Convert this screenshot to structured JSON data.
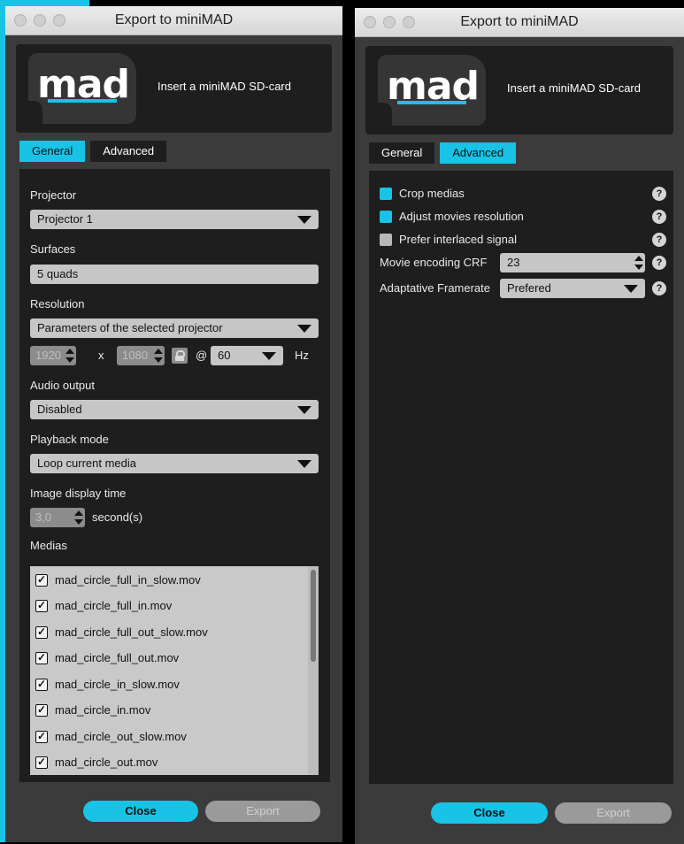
{
  "window_title": "Export to miniMAD",
  "logo_text": "mad",
  "insert_text": "Insert a miniMAD SD-card",
  "tabs": {
    "general": "General",
    "advanced": "Advanced"
  },
  "general": {
    "projector_label": "Projector",
    "projector_value": "Projector 1",
    "surfaces_label": "Surfaces",
    "surfaces_value": "5 quads",
    "resolution_label": "Resolution",
    "resolution_value": "Parameters of the selected projector",
    "width_value": "1920",
    "height_value": "1080",
    "x_sep": "x",
    "at_sep": "@",
    "refresh_value": "60",
    "hz_label": "Hz",
    "audio_label": "Audio output",
    "audio_value": "Disabled",
    "playback_label": "Playback mode",
    "playback_value": "Loop current media",
    "image_time_label": "Image display time",
    "image_time_value": "3,0",
    "seconds_label": "second(s)",
    "medias_label": "Medias",
    "medias": [
      "mad_circle_full_in_slow.mov",
      "mad_circle_full_in.mov",
      "mad_circle_full_out_slow.mov",
      "mad_circle_full_out.mov",
      "mad_circle_in_slow.mov",
      "mad_circle_in.mov",
      "mad_circle_out_slow.mov",
      "mad_circle_out.mov"
    ]
  },
  "advanced": {
    "crop_medias": "Crop medias",
    "adjust_resolution": "Adjust movies resolution",
    "prefer_interlaced": "Prefer interlaced signal",
    "crf_label": "Movie encoding CRF",
    "crf_value": "23",
    "framerate_label": "Adaptative Framerate",
    "framerate_value": "Prefered",
    "help_glyph": "?"
  },
  "buttons": {
    "close": "Close",
    "export": "Export"
  },
  "colors": {
    "accent": "#18c3e6",
    "panel": "#1e1e1e",
    "window": "#3b3b3b"
  }
}
